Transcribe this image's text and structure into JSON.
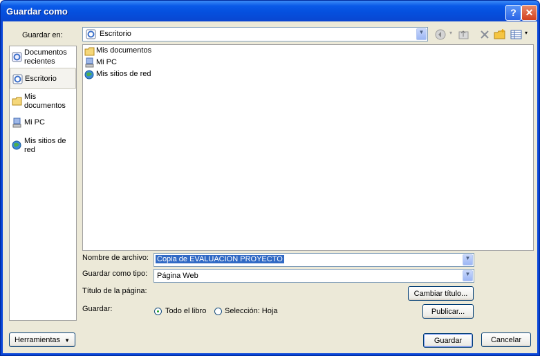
{
  "window": {
    "title": "Guardar como"
  },
  "save_in": {
    "label": "Guardar en:",
    "value": "Escritorio"
  },
  "places": [
    {
      "label": "Documentos recientes",
      "icon": "recent-documents-icon"
    },
    {
      "label": "Escritorio",
      "icon": "desktop-icon",
      "selected": true
    },
    {
      "label": "Mis documentos",
      "icon": "my-documents-icon"
    },
    {
      "label": "Mi PC",
      "icon": "my-computer-icon"
    },
    {
      "label": "Mis sitios de red",
      "icon": "network-places-icon"
    }
  ],
  "files": [
    {
      "name": "Mis documentos",
      "icon": "my-documents-icon"
    },
    {
      "name": "Mi PC",
      "icon": "my-computer-icon"
    },
    {
      "name": "Mis sitios de red",
      "icon": "network-places-icon"
    }
  ],
  "form": {
    "filename_label": "Nombre de archivo:",
    "filename_value": "Copia de EVALUACION PROYECTO",
    "type_label": "Guardar como tipo:",
    "type_value": "Página Web",
    "page_title_label": "Título de la página:",
    "change_title_button": "Cambiar título...",
    "save_label": "Guardar:",
    "option_all": "Todo el libro",
    "option_selection": "Selección: Hoja",
    "publish_button": "Publicar..."
  },
  "footer": {
    "tools_button": "Herramientas",
    "save_button": "Guardar",
    "cancel_button": "Cancelar"
  },
  "colors": {
    "title_bar": "#0a5ae8",
    "dialog_bg": "#ece9d8",
    "selection": "#316ac5"
  }
}
